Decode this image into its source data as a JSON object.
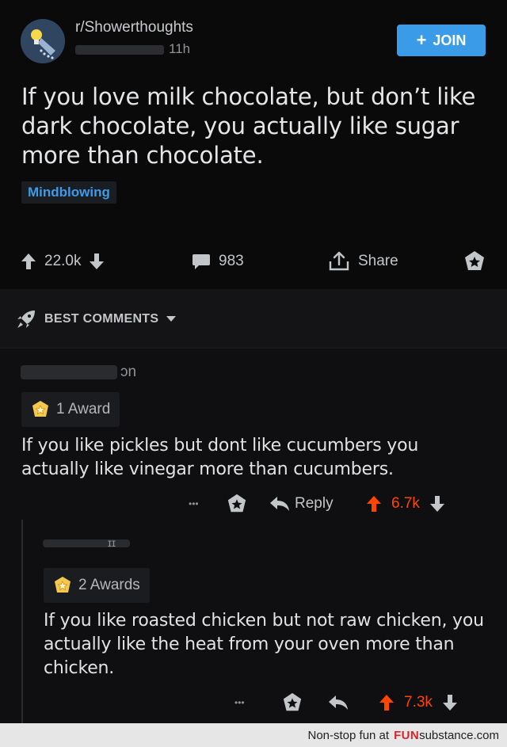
{
  "post": {
    "subreddit": "r/Showerthoughts",
    "age": "11h",
    "join_label": "JOIN",
    "title": "If you love milk chocolate, but don’t like dark chocolate, you actually like sugar more than chocolate.",
    "flair": "Mindblowing",
    "upvotes": "22.0k",
    "comments": "983",
    "share_label": "Share"
  },
  "sort": {
    "label": "BEST COMMENTS"
  },
  "comments": [
    {
      "username_fragment": "ɔn",
      "award": "1 Award",
      "text": "If you like pickles but dont like cucumbers you actually like vinegar more than cucumbers.",
      "more": "•••",
      "reply_label": "Reply",
      "score": "6.7k"
    },
    {
      "username_fragment": "ɪɪ",
      "award": "2 Awards",
      "text": "If you like roasted chicken but not raw chicken, you actually like the heat from your oven more than chicken.",
      "more": "•••",
      "score": "7.3k"
    }
  ],
  "footer": {
    "prefix": "Non-stop fun at",
    "brand_bold": "FUN",
    "brand_rest": "substance",
    "suffix": ".com"
  },
  "colors": {
    "accent": "#3a9ce8",
    "upvote": "#ff4500",
    "background": "#0b0b0c"
  }
}
